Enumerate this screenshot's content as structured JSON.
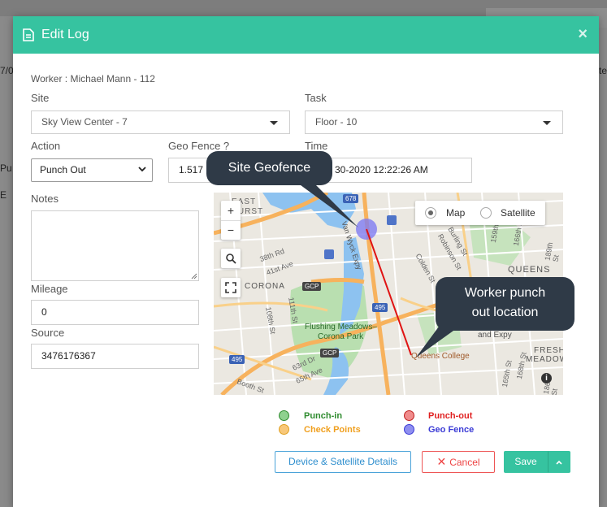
{
  "background": {
    "left_fragments": [
      "7/0",
      "Pu",
      "E"
    ],
    "right_fragment": "te"
  },
  "modal": {
    "title": "Edit Log",
    "close_glyph": "×",
    "worker_label": "Worker : Michael Mann - 112",
    "site": {
      "label": "Site",
      "value": "Sky View Center - 7"
    },
    "task": {
      "label": "Task",
      "value": "Floor - 10"
    },
    "action": {
      "label": "Action",
      "value": "Punch Out"
    },
    "geofence": {
      "label": "Geo Fence ?",
      "value": "1.517"
    },
    "time": {
      "label": "Time",
      "value": "30-2020 12:22:26 AM"
    },
    "notes": {
      "label": "Notes",
      "value": ""
    },
    "mileage": {
      "label": "Mileage",
      "value": "0"
    },
    "source": {
      "label": "Source",
      "value": "3476176367"
    }
  },
  "map": {
    "map_type_options": [
      "Map",
      "Satellite"
    ],
    "selected_map_type": "Map",
    "zoom_in": "+",
    "zoom_out": "−",
    "labels": {
      "east_elmhurst": "EAST",
      "elmhurst": "EHURST",
      "corona": "CORONA",
      "queens": "QUEENS",
      "fresh_meadows_1": "FRESH",
      "fresh_meadows_2": "MEADOW",
      "park_1": "Flushing Meadows–",
      "park_2": "Corona Park",
      "queens_college": "Queens College",
      "van_wyck": "Van Wyck Expy",
      "le_expy": "and Expy",
      "st_38": "38th Rd",
      "st_41": "41st Ave",
      "st_108": "108th St",
      "st_111": "111th St",
      "st_65": "65th Ave",
      "st_63": "63rd Dr",
      "booth": "Booth St",
      "burling": "Burling St",
      "robinson": "Robinson St",
      "colden": "Colden St",
      "st_150": "150th St",
      "st_159": "159th St",
      "st_160": "160th St",
      "st_166": "166th St",
      "st_189": "189th St",
      "st_168": "168th St",
      "st_165": "165th St",
      "st_186": "186th St",
      "shield_678": "678",
      "shield_495a": "495",
      "shield_495b": "495",
      "gcp1": "GCP",
      "gcp2": "GCP",
      "info": "i"
    },
    "callout_geofence": "Site Geofence",
    "callout_worker_line1": "Worker punch",
    "callout_worker_line2": "out location"
  },
  "legend": {
    "punch_in": "Punch-in",
    "punch_out": "Punch-out",
    "check_points": "Check Points",
    "geo_fence": "Geo Fence"
  },
  "buttons": {
    "device_details": "Device & Satellite Details",
    "cancel": "Cancel",
    "save": "Save"
  },
  "colors": {
    "header": "#36c3a0",
    "punch_in": "#2e8b2e",
    "punch_out": "#e02020",
    "check_points": "#f0a020",
    "geo_fence": "#3b3bd6",
    "callout": "#2f3a47"
  }
}
